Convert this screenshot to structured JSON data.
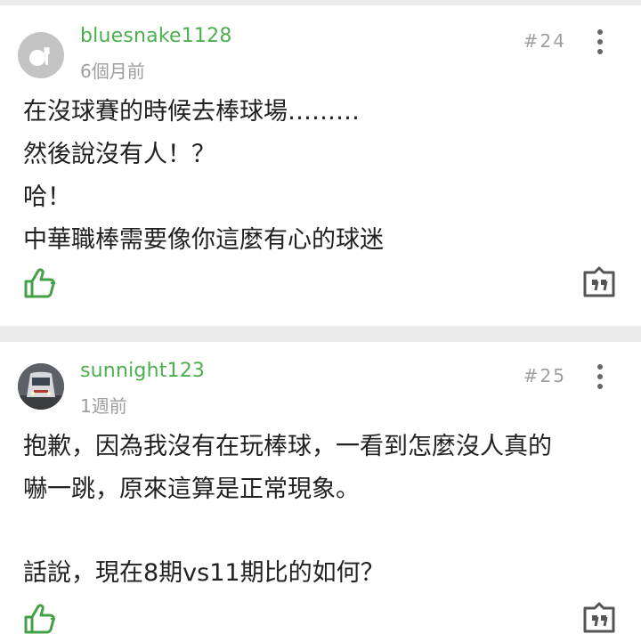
{
  "comments": [
    {
      "username": "bluesnake1128",
      "time": "6個月前",
      "floor": "#24",
      "lines": [
        "在沒球賽的時候去棒球場………",
        "然後說沒有人！？",
        "哈！",
        "中華職棒需要像你這麼有心的球迷"
      ]
    },
    {
      "username": "sunnight123",
      "time": "1週前",
      "floor": "#25",
      "lines": [
        "抱歉，因為我沒有在玩棒球，一看到怎麼沒人真的",
        "嚇一跳，原來這算是正常現象。",
        "",
        "話說，現在8期vs11期比的如何？"
      ]
    }
  ],
  "colors": {
    "username": "#4caf50",
    "like_icon": "#43a047",
    "meta": "#9e9e9e",
    "divider": "#ececec"
  },
  "icons": {
    "like": "thumbs-up-icon",
    "reply": "quote-icon",
    "more": "more-vertical-icon"
  }
}
